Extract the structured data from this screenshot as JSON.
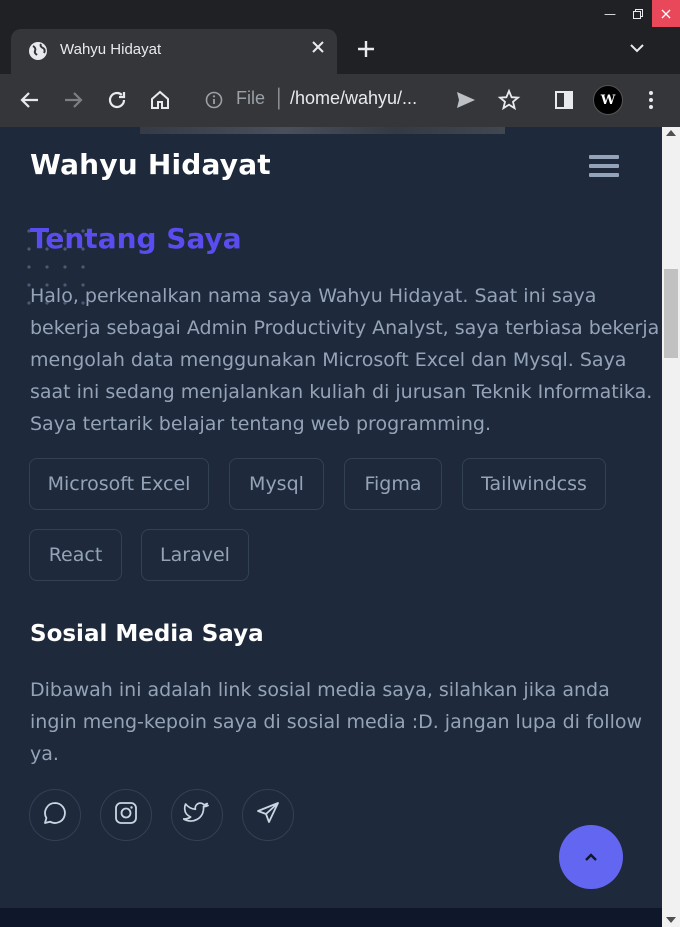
{
  "browser": {
    "tab_title": "Wahyu Hidayat",
    "address_scheme": "File",
    "address_url": "/home/wahyu/...",
    "profile_initials": "W",
    "icons": [
      "globe-icon",
      "close-icon",
      "plus-icon",
      "chevron-down-icon",
      "back-icon",
      "forward-icon",
      "reload-icon",
      "home-icon",
      "info-icon",
      "send-icon",
      "star-icon",
      "side-panel-icon",
      "kebab-menu-icon"
    ]
  },
  "header": {
    "site_title": "Wahyu Hidayat"
  },
  "about": {
    "heading": "Tentang Saya",
    "lines": [
      "Halo, perkenalkan nama saya Wahyu Hidayat. Saat ini saya",
      "bekerja sebagai Admin Productivity Analyst, saya terbiasa bekerja",
      "mengolah data menggunakan Microsoft Excel dan Mysql. Saya",
      "saat ini sedang menjalankan kuliah di jurusan Teknik Informatika.",
      "Saya tertarik belajar tentang web programming."
    ],
    "skills": [
      "Microsoft Excel",
      "Mysql",
      "Figma",
      "Tailwindcss",
      "React",
      "Laravel"
    ]
  },
  "social": {
    "heading": "Sosial Media Saya",
    "lines": [
      "Dibawah ini adalah link sosial media saya, silahkan jika anda",
      "ingin meng-kepoin saya di sosial media :D. jangan lupa di follow",
      "ya."
    ],
    "links": [
      "whatsapp-icon",
      "instagram-icon",
      "twitter-icon",
      "telegram-icon"
    ]
  },
  "colors": {
    "page_bg": "#1e293b",
    "accent": "#5b4cf0",
    "button": "#6366f1",
    "text_muted": "#94a3b8",
    "border": "#334155"
  }
}
